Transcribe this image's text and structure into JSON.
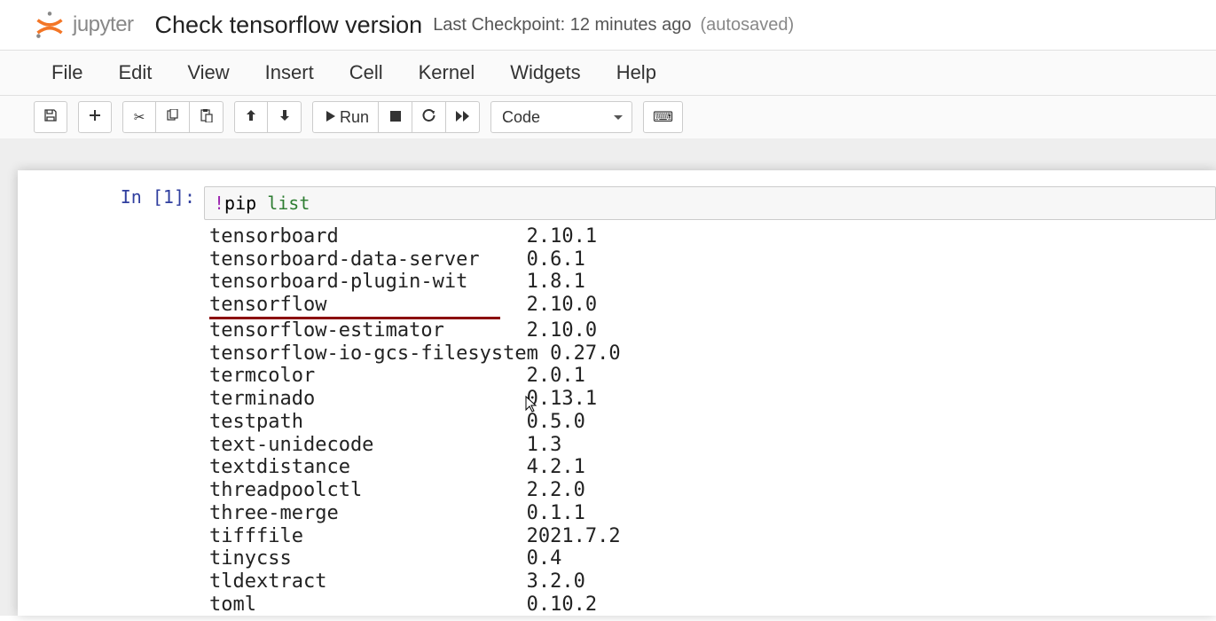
{
  "header": {
    "logo_text": "jupyter",
    "title": "Check tensorflow version",
    "checkpoint": "Last Checkpoint: 12 minutes ago",
    "autosave": "(autosaved)"
  },
  "menu": {
    "file": "File",
    "edit": "Edit",
    "view": "View",
    "insert": "Insert",
    "cell": "Cell",
    "kernel": "Kernel",
    "widgets": "Widgets",
    "help": "Help"
  },
  "toolbar": {
    "run_label": "Run",
    "celltype": "Code"
  },
  "cell": {
    "prompt": "In [1]:",
    "code_magic": "!",
    "code_plain": "pip ",
    "code_cmd": "list"
  },
  "output": {
    "packages": [
      {
        "name": "tensorboard",
        "version": "2.10.1"
      },
      {
        "name": "tensorboard-data-server",
        "version": "0.6.1"
      },
      {
        "name": "tensorboard-plugin-wit",
        "version": "1.8.1"
      },
      {
        "name": "tensorflow",
        "version": "2.10.0",
        "underline": true
      },
      {
        "name": "tensorflow-estimator",
        "version": "2.10.0"
      },
      {
        "name": "tensorflow-io-gcs-filesystem",
        "version": "0.27.0"
      },
      {
        "name": "termcolor",
        "version": "2.0.1"
      },
      {
        "name": "terminado",
        "version": "0.13.1"
      },
      {
        "name": "testpath",
        "version": "0.5.0"
      },
      {
        "name": "text-unidecode",
        "version": "1.3"
      },
      {
        "name": "textdistance",
        "version": "4.2.1"
      },
      {
        "name": "threadpoolctl",
        "version": "2.2.0"
      },
      {
        "name": "three-merge",
        "version": "0.1.1"
      },
      {
        "name": "tifffile",
        "version": "2021.7.2"
      },
      {
        "name": "tinycss",
        "version": "0.4"
      },
      {
        "name": "tldextract",
        "version": "3.2.0"
      },
      {
        "name": "toml",
        "version": "0.10.2"
      }
    ]
  }
}
